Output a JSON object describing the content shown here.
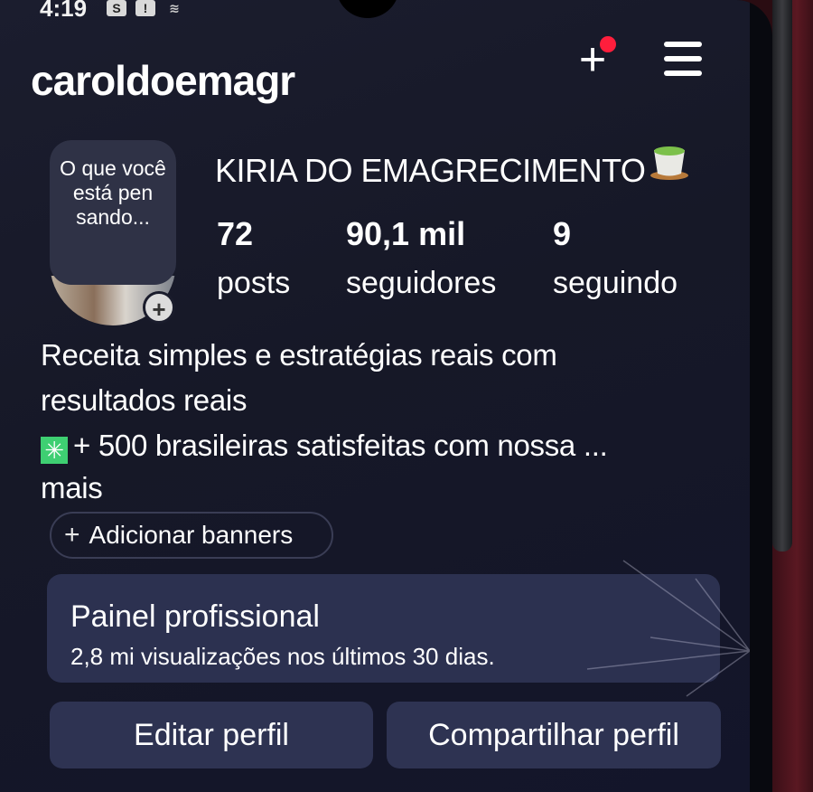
{
  "status_bar": {
    "time": "4:19",
    "icons": [
      "s-app-icon",
      "notification-icon",
      "signal-icon"
    ]
  },
  "header": {
    "username": "caroldoemagr",
    "create_icon": "plus-icon",
    "menu_icon": "hamburger-menu-icon"
  },
  "profile": {
    "note": "O que você está pen sando...",
    "display_name": "KIRIA DO EMAGRECIMENTO",
    "name_emoji": "tea-cup-icon",
    "stats": {
      "posts_count": "72",
      "posts_label": "posts",
      "followers_count": "90,1 mil",
      "followers_label": "seguidores",
      "following_count": "9",
      "following_label": "seguindo"
    }
  },
  "bio": {
    "line1": "Receita simples e estratégias reais com resultados reais",
    "line2": "+ 500 brasileiras satisfeitas com nossa ...",
    "more": "mais"
  },
  "banners": {
    "label": "Adicionar banners"
  },
  "dashboard": {
    "title": "Painel profissional",
    "subtitle": "2,8 mi visualizações nos últimos 30 dias."
  },
  "actions": {
    "edit": "Editar perfil",
    "share": "Compartilhar perfil"
  },
  "colors": {
    "background": "#161827",
    "card": "#2c3150",
    "notification_dot": "#ff1e3c",
    "sparkle": "#3ecf72"
  }
}
